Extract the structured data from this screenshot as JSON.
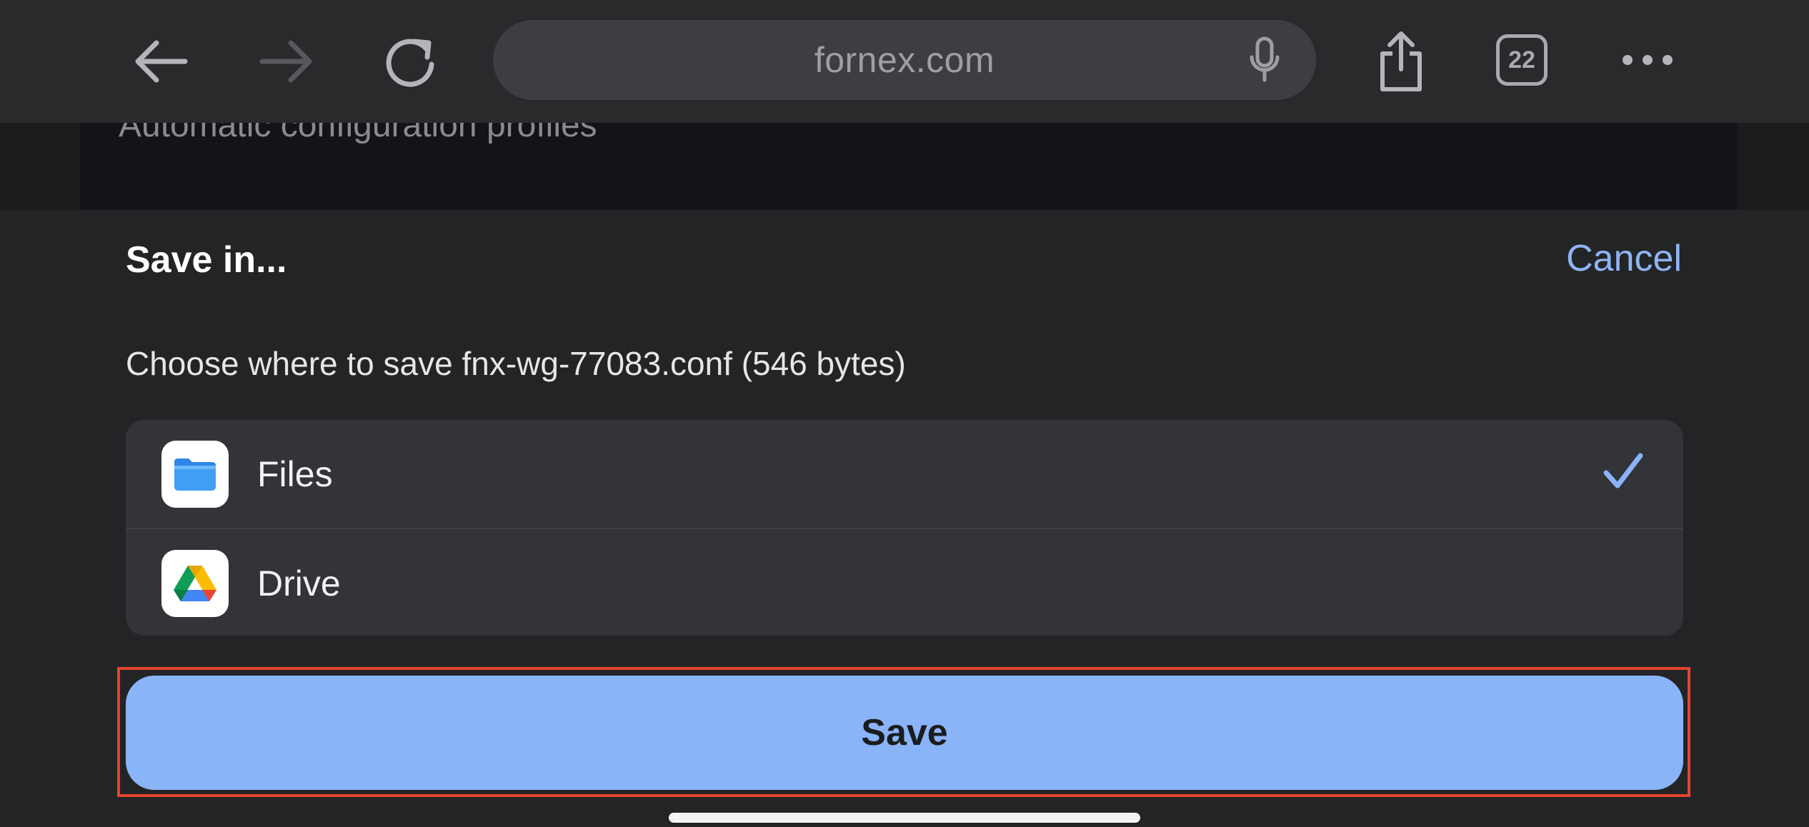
{
  "browser": {
    "url": "fornex.com",
    "tab_count": "22",
    "icons": {
      "back": "arrow-left-icon",
      "forward": "arrow-right-icon",
      "reload": "reload-icon",
      "mic": "microphone-icon",
      "share": "share-icon",
      "tabs": "tab-switcher-icon",
      "menu": "more-dots-icon"
    }
  },
  "page": {
    "partial_text": "Automatic configuration profiles"
  },
  "sheet": {
    "title": "Save in...",
    "cancel_label": "Cancel",
    "description": "Choose where to save fnx-wg-77083.conf (546 bytes)",
    "options": [
      {
        "label": "Files",
        "icon": "files-folder-icon",
        "selected": true
      },
      {
        "label": "Drive",
        "icon": "google-drive-icon",
        "selected": false
      }
    ],
    "save_label": "Save"
  },
  "colors": {
    "accent": "#8ab4f8",
    "link": "#8fb4f4",
    "highlight_border": "#e5432f",
    "sheet_bg": "#232426",
    "options_bg": "#333438"
  }
}
